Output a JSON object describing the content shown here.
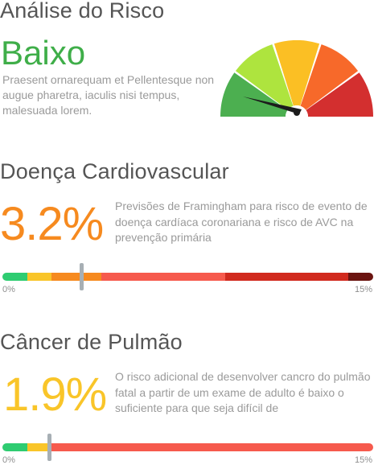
{
  "risk_analysis": {
    "title": "Análise do Risco",
    "level": "Baixo",
    "level_color": "#3fae49",
    "description": "Praesent ornarequam et Pellentesque non augue pharetra, iaculis nisi tempus, malesuada lorem.",
    "gauge": {
      "segments": [
        "#4caf50",
        "#aee43e",
        "#fbbf24",
        "#f7692a",
        "#d32f2f"
      ],
      "needle_color": "#1c1c1c"
    }
  },
  "cardio": {
    "title": "Doença Cardiovascular",
    "value": "3.2%",
    "value_color": "#f68a1f",
    "description": "Previsões de Framingham para risco de evento de doença cardíaca coronariana e risco de AVC na prevenção primária",
    "scale_min": "0%",
    "scale_max": "15%",
    "marker_value": 3.2,
    "scale_max_value": 15,
    "bar_segments": [
      {
        "color": "#2ecc71",
        "from": 0,
        "to": 1
      },
      {
        "color": "#f9c529",
        "from": 1,
        "to": 2
      },
      {
        "color": "#f68a1f",
        "from": 2,
        "to": 4
      },
      {
        "color": "#f65a4d",
        "from": 4,
        "to": 9
      },
      {
        "color": "#d12a1e",
        "from": 9,
        "to": 14
      },
      {
        "color": "#6b1410",
        "from": 14,
        "to": 15
      }
    ]
  },
  "lung": {
    "title": "Câncer de Pulmão",
    "value": "1.9%",
    "value_color": "#f9c529",
    "description": "O risco adicional de desenvolver cancro do pulmão fatal a partir de um exame de adulto é baixo o suficiente para que seja difícil de",
    "scale_min": "0%",
    "scale_max": "15%",
    "marker_value": 1.9,
    "scale_max_value": 15,
    "bar_segments": [
      {
        "color": "#2ecc71",
        "from": 0,
        "to": 1
      },
      {
        "color": "#f9c529",
        "from": 1,
        "to": 2
      },
      {
        "color": "#f65a4d",
        "from": 2,
        "to": 15
      }
    ]
  }
}
